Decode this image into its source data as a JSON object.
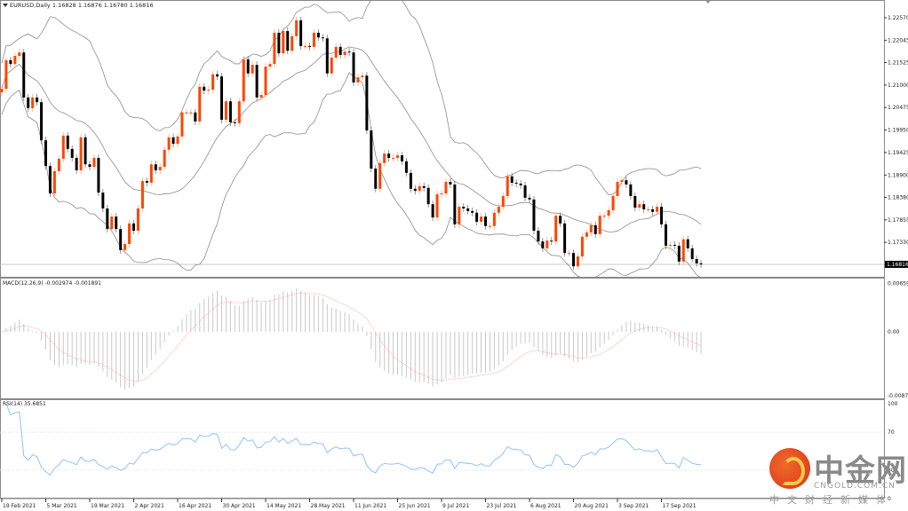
{
  "header": {
    "symbol": "EURUSD,Daily",
    "ohlc": "1.16828 1.16876 1.16780 1.16816"
  },
  "colors": {
    "bull": "#ff4500",
    "bear": "#000000",
    "bands": "#8c8c8c",
    "macd_hist": "#c8c8c8",
    "macd_signal": "#ff9a9a",
    "rsi": "#8fc3f5",
    "grid": "#c8c8c8"
  },
  "watermark": {
    "brand_cn": "中金网",
    "brand_en": "CNGOLD.COM.CN",
    "tagline": "中文财经新媒体"
  },
  "chart_data": [
    {
      "type": "candlestick",
      "title": "EURUSD,Daily",
      "indicator": "Bollinger Bands",
      "current_price": "1.16816",
      "y_ticks": [
        "1.22570",
        "1.22045",
        "1.21525",
        "1.21000",
        "1.20475",
        "1.19950",
        "1.19425",
        "1.18900",
        "1.18380",
        "1.17855",
        "1.17330"
      ],
      "x_ticks": [
        "19 Feb 2021",
        "5 Mar 2021",
        "19 Mar 2021",
        "2 Apr 2021",
        "16 Apr 2021",
        "30 Apr 2021",
        "14 May 2021",
        "28 May 2021",
        "11 Jun 2021",
        "25 Jun 2021",
        "9 Jul 2021",
        "23 Jul 2021",
        "6 Aug 2021",
        "20 Aug 2021",
        "3 Sep 2021",
        "17 Sep 2021"
      ],
      "x_tick_step_bars": 10,
      "close": [
        1.2091,
        1.2158,
        1.2149,
        1.2168,
        1.2176,
        1.2071,
        1.2046,
        1.2071,
        1.206,
        1.1971,
        1.1911,
        1.1847,
        1.1899,
        1.1928,
        1.1982,
        1.1951,
        1.193,
        1.1901,
        1.1978,
        1.1915,
        1.1909,
        1.193,
        1.1849,
        1.1812,
        1.1764,
        1.1793,
        1.1764,
        1.1715,
        1.1729,
        1.1777,
        1.176,
        1.1812,
        1.1876,
        1.1872,
        1.1915,
        1.1901,
        1.1909,
        1.1949,
        1.1978,
        1.1963,
        1.198,
        1.2036,
        1.2036,
        1.2036,
        1.2015,
        1.2096,
        1.2087,
        1.2089,
        1.2125,
        1.212,
        1.2019,
        1.2062,
        1.2013,
        1.2011,
        1.2062,
        1.216,
        1.2127,
        1.2147,
        1.2071,
        1.2077,
        1.2143,
        1.2149,
        1.2222,
        1.2174,
        1.2226,
        1.218,
        1.2214,
        1.2251,
        1.2191,
        1.2191,
        1.2189,
        1.2222,
        1.2211,
        1.2209,
        1.2127,
        1.2164,
        1.2189,
        1.217,
        1.2178,
        1.2176,
        1.2106,
        1.2118,
        1.2122,
        1.1994,
        1.1905,
        1.1858,
        1.1918,
        1.194,
        1.193,
        1.193,
        1.1936,
        1.1922,
        1.1895,
        1.1858,
        1.1853,
        1.1864,
        1.186,
        1.1822,
        1.1791,
        1.1845,
        1.1847,
        1.1874,
        1.1868,
        1.1775,
        1.1816,
        1.1812,
        1.1806,
        1.1802,
        1.1781,
        1.1793,
        1.1771,
        1.1771,
        1.1802,
        1.1816,
        1.1841,
        1.1887,
        1.1872,
        1.187,
        1.1866,
        1.1837,
        1.1833,
        1.176,
        1.1735,
        1.1719,
        1.1737,
        1.1735,
        1.1795,
        1.1777,
        1.1708,
        1.1708,
        1.1677,
        1.17,
        1.1746,
        1.1756,
        1.1773,
        1.1752,
        1.1795,
        1.1795,
        1.1808,
        1.1841,
        1.1874,
        1.1878,
        1.1868,
        1.1841,
        1.1814,
        1.1822,
        1.181,
        1.181,
        1.1804,
        1.1816,
        1.1775,
        1.1725,
        1.1727,
        1.1725,
        1.1688,
        1.174,
        1.1719,
        1.1694,
        1.1684,
        1.16816
      ],
      "ylim": [
        1.165,
        1.231
      ]
    },
    {
      "type": "bar+line",
      "title": "MACD(12,26,9) -0.002974 -0.001891",
      "y_ticks": [
        "0.006595",
        "0.00",
        "-0.008704"
      ],
      "ylim": [
        -0.008704,
        0.006595
      ]
    },
    {
      "type": "line",
      "title": "RSI(14) 35.6851",
      "y_ticks": [
        "100",
        "70",
        "30",
        "0"
      ],
      "levels": [
        70,
        30
      ],
      "ylim": [
        0,
        100
      ]
    }
  ]
}
